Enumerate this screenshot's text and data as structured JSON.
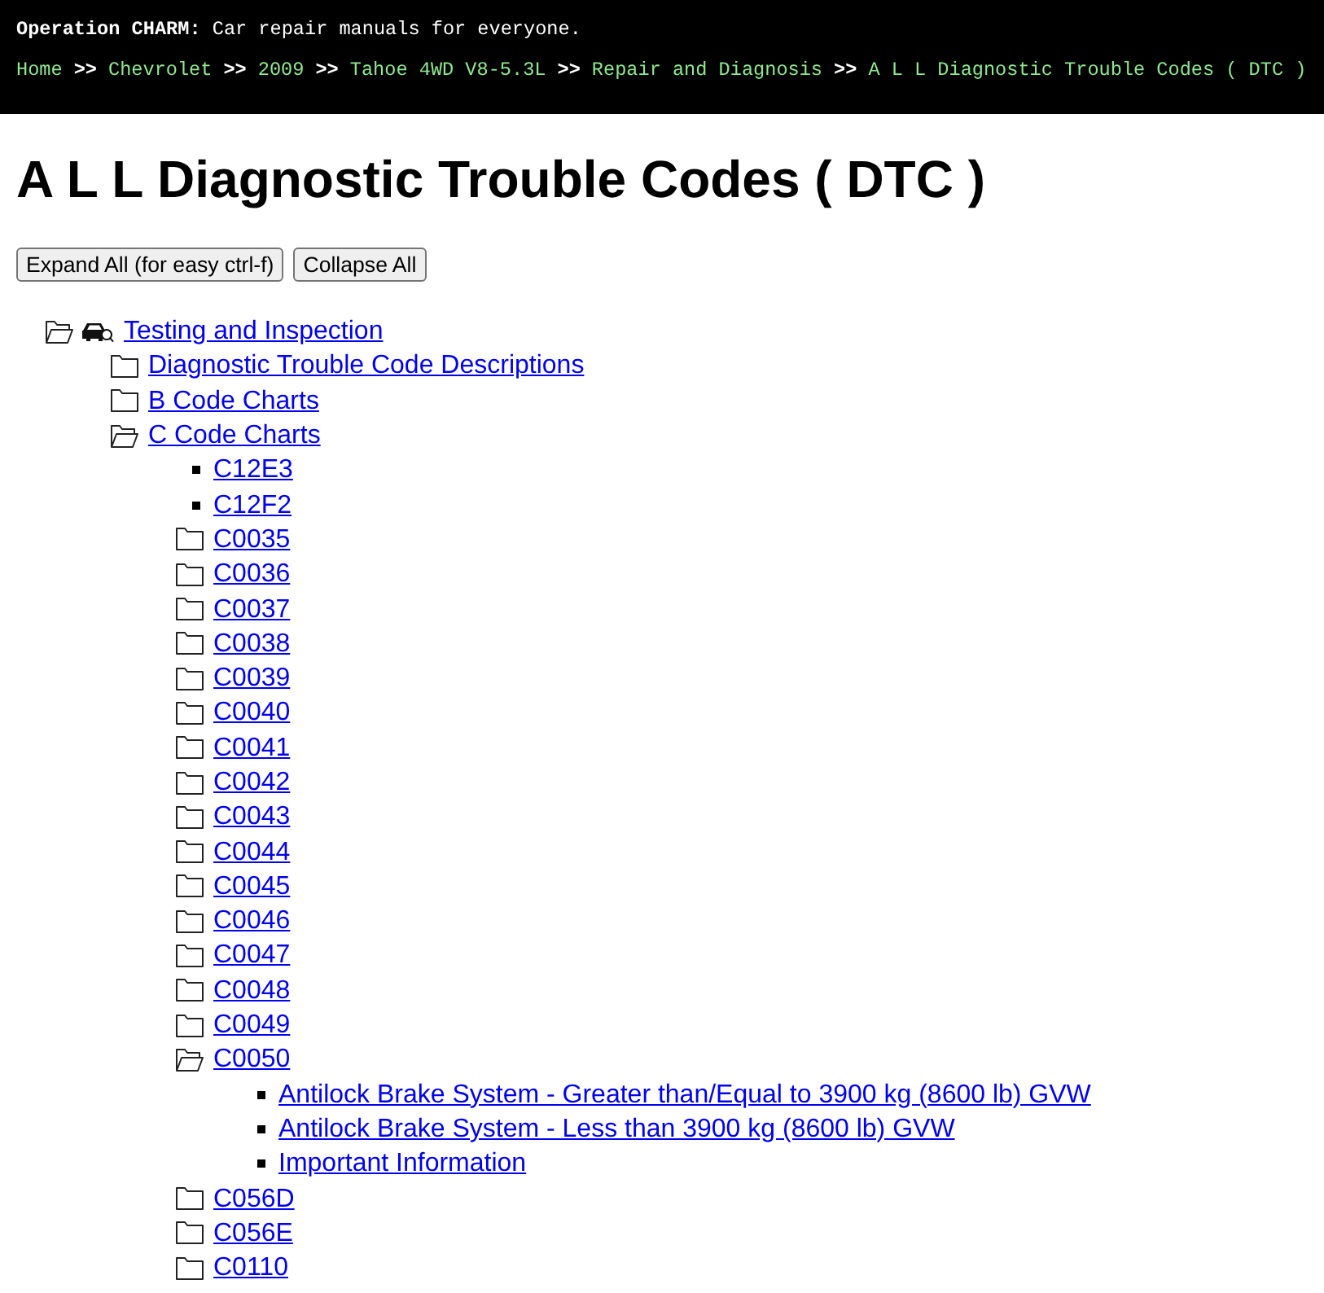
{
  "header": {
    "tagline": "**Operation CHARM:** Car repair manuals for everyone.",
    "breadcrumb": [
      {
        "kind": "link",
        "text": "Home"
      },
      {
        "kind": "separator",
        "text": ">>"
      },
      {
        "kind": "link",
        "text": "Chevrolet"
      },
      {
        "kind": "separator",
        "text": ">>"
      },
      {
        "kind": "link",
        "text": "2009"
      },
      {
        "kind": "separator",
        "text": ">>"
      },
      {
        "kind": "link",
        "text": "Tahoe 4WD V8-5.3L"
      },
      {
        "kind": "separator",
        "text": ">>"
      },
      {
        "kind": "link",
        "text": "Repair and Diagnosis"
      },
      {
        "kind": "separator",
        "text": ">>"
      },
      {
        "kind": "link",
        "text": "A L L Diagnostic Trouble Codes ( DTC )"
      }
    ]
  },
  "page": {
    "title": "A L L Diagnostic Trouble Codes ( DTC )",
    "buttons": [
      "Expand All (for easy ctrl-f)",
      "Collapse All"
    ]
  },
  "tree": [
    {
      "kind": "category",
      "label": "Testing and Inspection",
      "expanded": true,
      "children": [
        {
          "kind": "folder",
          "label": "Diagnostic Trouble Code Descriptions",
          "expanded": false
        },
        {
          "kind": "folder",
          "label": "B Code Charts",
          "expanded": false
        },
        {
          "kind": "folder",
          "label": "C Code Charts",
          "expanded": true,
          "children": [
            {
              "kind": "page",
              "label": "C12E3"
            },
            {
              "kind": "page",
              "label": "C12F2"
            },
            {
              "kind": "folder",
              "label": "C0035",
              "expanded": false
            },
            {
              "kind": "folder",
              "label": "C0036",
              "expanded": false
            },
            {
              "kind": "folder",
              "label": "C0037",
              "expanded": false
            },
            {
              "kind": "folder",
              "label": "C0038",
              "expanded": false
            },
            {
              "kind": "folder",
              "label": "C0039",
              "expanded": false
            },
            {
              "kind": "folder",
              "label": "C0040",
              "expanded": false
            },
            {
              "kind": "folder",
              "label": "C0041",
              "expanded": false
            },
            {
              "kind": "folder",
              "label": "C0042",
              "expanded": false
            },
            {
              "kind": "folder",
              "label": "C0043",
              "expanded": false
            },
            {
              "kind": "folder",
              "label": "C0044",
              "expanded": false
            },
            {
              "kind": "folder",
              "label": "C0045",
              "expanded": false
            },
            {
              "kind": "folder",
              "label": "C0046",
              "expanded": false
            },
            {
              "kind": "folder",
              "label": "C0047",
              "expanded": false
            },
            {
              "kind": "folder",
              "label": "C0048",
              "expanded": false
            },
            {
              "kind": "folder",
              "label": "C0049",
              "expanded": false
            },
            {
              "kind": "folder",
              "label": "C0050",
              "expanded": true,
              "children": [
                {
                  "kind": "page",
                  "label": "Antilock Brake System - Greater than/Equal to 3900 kg (8600 lb) GVW"
                },
                {
                  "kind": "page",
                  "label": "Antilock Brake System - Less than 3900 kg (8600 lb) GVW"
                },
                {
                  "kind": "page",
                  "label": "Important Information"
                }
              ]
            },
            {
              "kind": "folder",
              "label": "C056D",
              "expanded": false
            },
            {
              "kind": "folder",
              "label": "C056E",
              "expanded": false
            },
            {
              "kind": "folder",
              "label": "C0110",
              "expanded": false
            }
          ]
        }
      ]
    }
  ]
}
